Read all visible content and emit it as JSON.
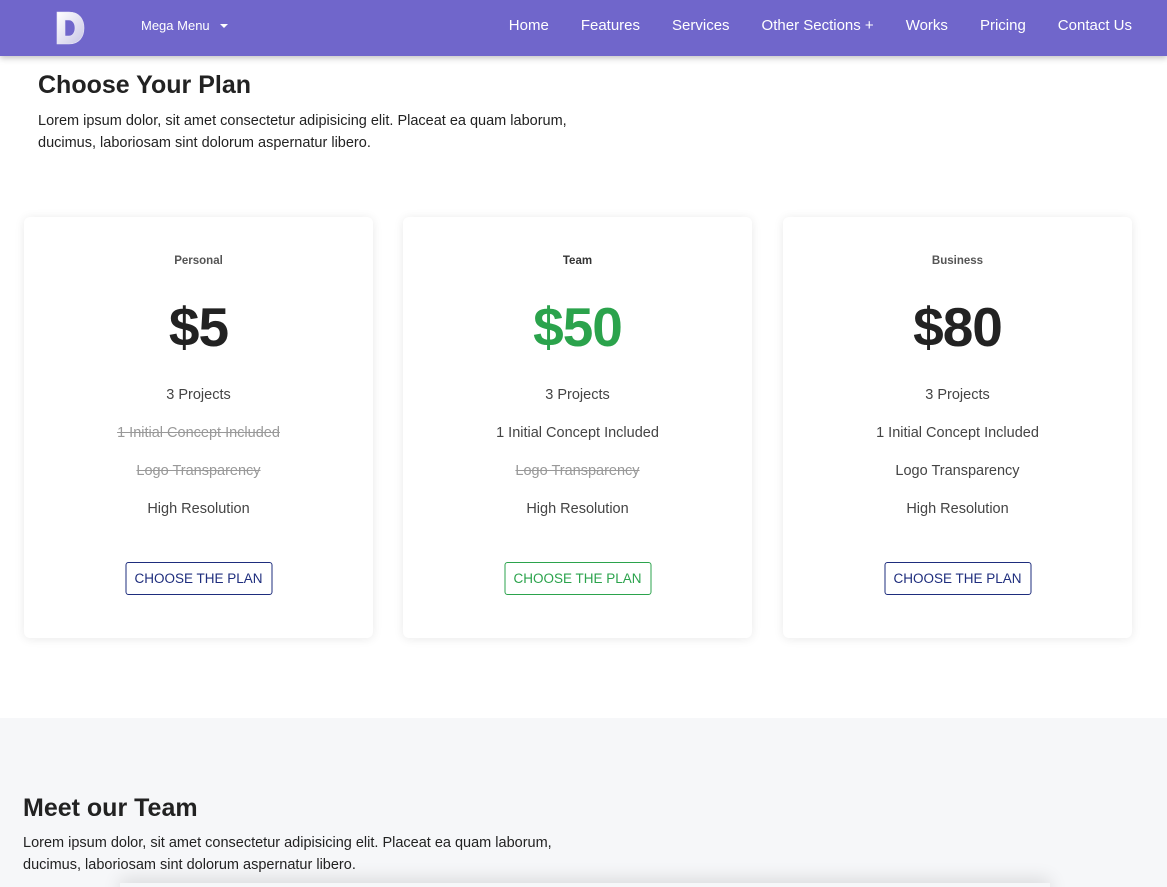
{
  "nav": {
    "logo_letter": "D",
    "mega_menu": "Mega Menu",
    "links": [
      "Home",
      "Features",
      "Services",
      "Other Sections +",
      "Works",
      "Pricing",
      "Contact Us"
    ]
  },
  "plans_section": {
    "title": "Choose Your Plan",
    "description": "Lorem ipsum dolor, sit amet consectetur adipisicing elit. Placeat ea quam laborum, ducimus, laboriosam sint dolorum aspernatur libero."
  },
  "plans": [
    {
      "name": "Personal",
      "price": "$5",
      "features": [
        {
          "label": "3 Projects",
          "included": true
        },
        {
          "label": "1 Initial Concept Included",
          "included": false
        },
        {
          "label": "Logo Transparency",
          "included": false
        },
        {
          "label": "High Resolution",
          "included": true
        }
      ],
      "button": "CHOOSE THE PLAN"
    },
    {
      "name": "Team",
      "price": "$50",
      "features": [
        {
          "label": "3 Projects",
          "included": true
        },
        {
          "label": "1 Initial Concept Included",
          "included": true
        },
        {
          "label": "Logo Transparency",
          "included": false
        },
        {
          "label": "High Resolution",
          "included": true
        }
      ],
      "button": "CHOOSE THE PLAN"
    },
    {
      "name": "Business",
      "price": "$80",
      "features": [
        {
          "label": "3 Projects",
          "included": true
        },
        {
          "label": "1 Initial Concept Included",
          "included": true
        },
        {
          "label": "Logo Transparency",
          "included": true
        },
        {
          "label": "High Resolution",
          "included": true
        }
      ],
      "button": "CHOOSE THE PLAN"
    }
  ],
  "team_section": {
    "title": "Meet our Team",
    "description": "Lorem ipsum dolor, sit amet consectetur adipisicing elit. Placeat ea quam laborum, ducimus, laboriosam sint dolorum aspernatur libero."
  },
  "colors": {
    "navbar": "#7066cb",
    "accent_green": "#2ba34c",
    "button_blue": "#1e2d7d"
  }
}
